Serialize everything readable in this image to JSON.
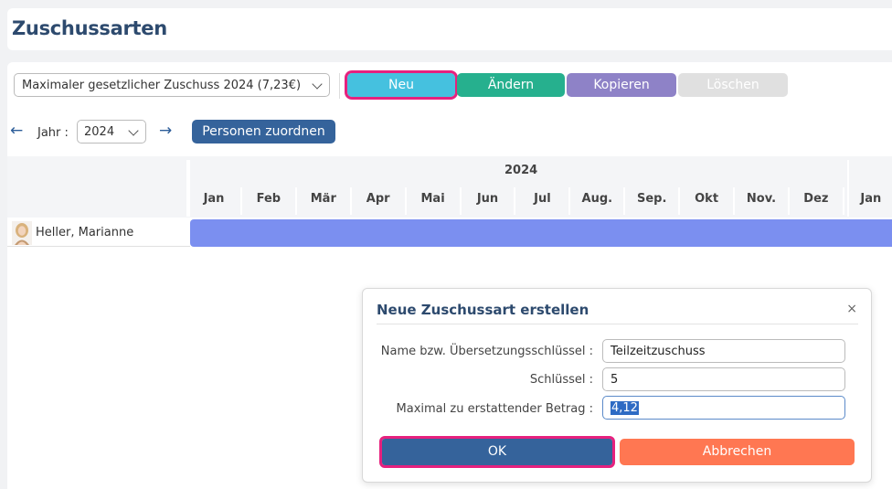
{
  "page": {
    "title": "Zuschussarten"
  },
  "toolbar": {
    "select_value": "Maximaler gesetzlicher Zuschuss 2024 (7,23€)",
    "buttons": {
      "neu": "Neu",
      "aendern": "Ändern",
      "kopieren": "Kopieren",
      "loeschen": "Löschen"
    },
    "year_label": "Jahr :",
    "year_value": "2024",
    "assign_button": "Personen zuordnen"
  },
  "timeline": {
    "year": "2024",
    "months": [
      "Jan",
      "Feb",
      "Mär",
      "Apr",
      "Mai",
      "Jun",
      "Jul",
      "Aug.",
      "Sep.",
      "Okt",
      "Nov.",
      "Dez",
      "Jan"
    ]
  },
  "persons": [
    {
      "name": "Heller, Marianne"
    }
  ],
  "dialog": {
    "title": "Neue Zuschussart erstellen",
    "close_icon": "×",
    "fields": [
      {
        "label": "Name bzw. Übersetzungsschlüssel :",
        "value": "Teilzeitzuschuss"
      },
      {
        "label": "Schlüssel :",
        "value": "5"
      },
      {
        "label": "Maximal zu erstattender Betrag :",
        "value": "4,12"
      }
    ],
    "ok": "OK",
    "cancel": "Abbrechen"
  },
  "colors": {
    "title": "#2d4a6e",
    "neu": "#45c1df",
    "aendern": "#26b08e",
    "kopieren": "#8e82c7",
    "loeschen": "#e0e0e0",
    "primary": "#35639b",
    "cancel": "#ff7752",
    "bar": "#7b8ff0",
    "highlight": "#e6217e"
  }
}
